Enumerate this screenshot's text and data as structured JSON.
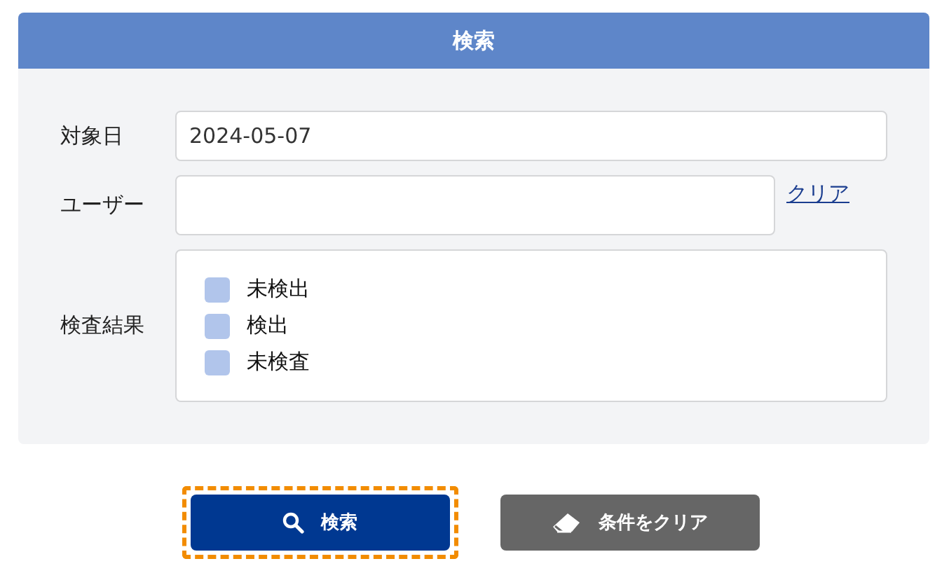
{
  "panel": {
    "title": "検索"
  },
  "fields": [
    {
      "label": "対象日",
      "value": "2024-05-07"
    },
    {
      "label": "ユーザー",
      "link": "クリア"
    }
  ],
  "result_filter": {
    "label": "検査結果",
    "options": [
      {
        "label": "未検出",
        "checked": false
      },
      {
        "label": "検出",
        "checked": false
      },
      {
        "label": "未検査",
        "checked": false
      }
    ]
  },
  "buttons": [
    {
      "kind": "search",
      "label": "検索",
      "focused": true
    },
    {
      "kind": "clear",
      "label": "条件をクリア",
      "focused": false
    }
  ]
}
